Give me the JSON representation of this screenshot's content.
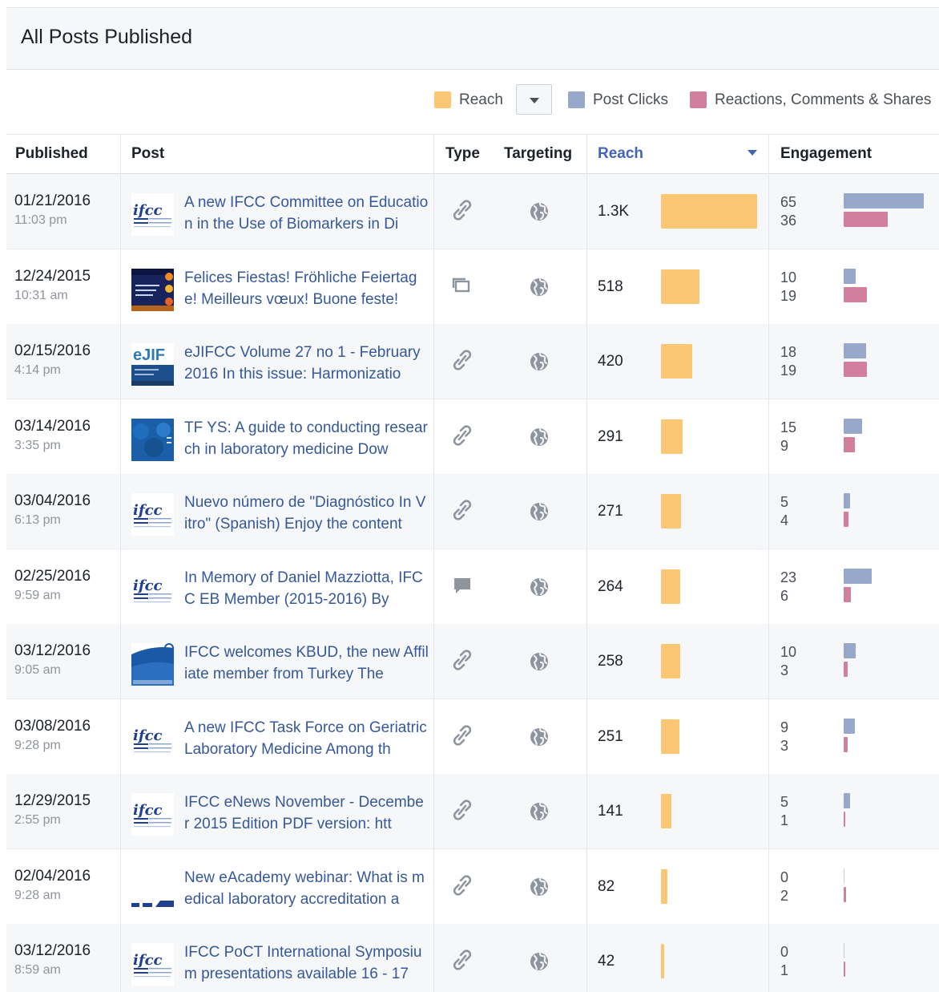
{
  "page": {
    "title": "All Posts Published"
  },
  "legend": {
    "reach_label": "Reach",
    "post_clicks_label": "Post Clicks",
    "rcs_label": "Reactions, Comments & Shares",
    "colors": {
      "reach": "#fbc775",
      "post_clicks": "#98a8cb",
      "rcs": "#d17f9c"
    }
  },
  "columns": {
    "published": "Published",
    "post": "Post",
    "type": "Type",
    "targeting": "Targeting",
    "reach": "Reach",
    "engagement": "Engagement"
  },
  "rows": [
    {
      "date": "01/21/2016",
      "time": "11:03 pm",
      "post": "A new IFCC Committee on Education in the Use of Biomarkers in Di",
      "type_icon": "link-icon",
      "thumb": "ifcc-logo",
      "reach_label": "1.3K",
      "reach": 1300,
      "post_clicks": 65,
      "rcs": 36
    },
    {
      "date": "12/24/2015",
      "time": "10:31 am",
      "post": "Felices Fiestas! Fröhliche Feiertage! Meilleurs vœux! Buone feste!",
      "type_icon": "album-icon",
      "thumb": "holiday-card",
      "reach_label": "518",
      "reach": 518,
      "post_clicks": 10,
      "rcs": 19
    },
    {
      "date": "02/15/2016",
      "time": "4:14 pm",
      "post": "eJIFCC Volume 27 no 1 - February 2016 In this issue: Harmonizatio",
      "type_icon": "link-icon",
      "thumb": "ejifcc-cover",
      "reach_label": "420",
      "reach": 420,
      "post_clicks": 18,
      "rcs": 19
    },
    {
      "date": "03/14/2016",
      "time": "3:35 pm",
      "post": "TF YS: A guide to conducting research in laboratory medicine Dow",
      "type_icon": "link-icon",
      "thumb": "tfys-cover",
      "reach_label": "291",
      "reach": 291,
      "post_clicks": 15,
      "rcs": 9
    },
    {
      "date": "03/04/2016",
      "time": "6:13 pm",
      "post": "Nuevo número de \"Diagnóstico In Vitro\" (Spanish) Enjoy the content",
      "type_icon": "link-icon",
      "thumb": "ifcc-logo",
      "reach_label": "271",
      "reach": 271,
      "post_clicks": 5,
      "rcs": 4
    },
    {
      "date": "02/25/2016",
      "time": "9:59 am",
      "post": "In Memory of Daniel Mazziotta, IFCC EB Member (2015-2016) By",
      "type_icon": "status-icon",
      "thumb": "ifcc-logo",
      "reach_label": "264",
      "reach": 264,
      "post_clicks": 23,
      "rcs": 6
    },
    {
      "date": "03/12/2016",
      "time": "9:05 am",
      "post": "IFCC welcomes KBUD, the new Affiliate member from Turkey The",
      "type_icon": "link-icon",
      "thumb": "kbud-cover",
      "reach_label": "258",
      "reach": 258,
      "post_clicks": 10,
      "rcs": 3
    },
    {
      "date": "03/08/2016",
      "time": "9:28 pm",
      "post": "A new IFCC Task Force on Geriatric Laboratory Medicine Among th",
      "type_icon": "link-icon",
      "thumb": "ifcc-logo",
      "reach_label": "251",
      "reach": 251,
      "post_clicks": 9,
      "rcs": 3
    },
    {
      "date": "12/29/2015",
      "time": "2:55 pm",
      "post": "IFCC eNews November - December 2015 Edition PDF version: htt",
      "type_icon": "link-icon",
      "thumb": "ifcc-logo",
      "reach_label": "141",
      "reach": 141,
      "post_clicks": 5,
      "rcs": 1
    },
    {
      "date": "02/04/2016",
      "time": "9:28 am",
      "post": "New eAcademy webinar: What is medical laboratory accreditation a",
      "type_icon": "link-icon",
      "thumb": "eacademy-cover",
      "reach_label": "82",
      "reach": 82,
      "post_clicks": 0,
      "rcs": 2
    },
    {
      "date": "03/12/2016",
      "time": "8:59 am",
      "post": "IFCC PoCT International Symposium presentations available 16 - 17",
      "type_icon": "link-icon",
      "thumb": "ifcc-logo",
      "reach_label": "42",
      "reach": 42,
      "post_clicks": 0,
      "rcs": 1
    }
  ]
}
